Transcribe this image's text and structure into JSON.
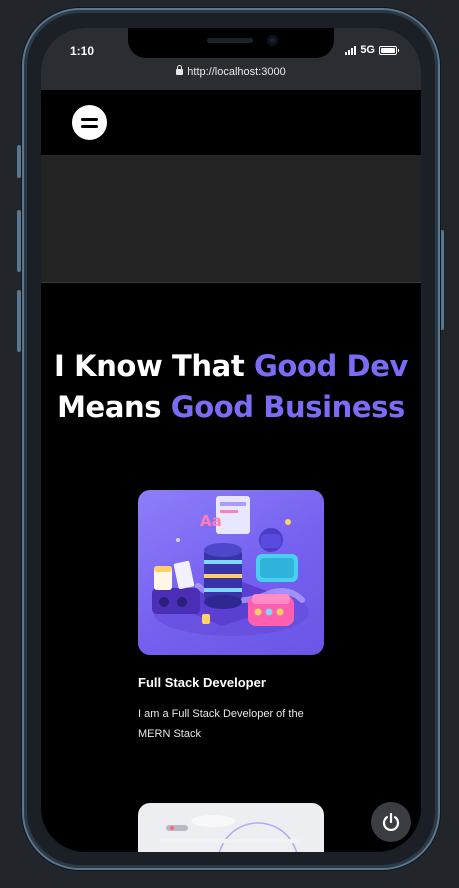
{
  "status_bar": {
    "time": "1:10",
    "network": "5G"
  },
  "browser": {
    "url": "http://localhost:3000"
  },
  "hero": {
    "line1_plain": "I Know That ",
    "line1_accent": "Good Dev",
    "line2_plain": "Means ",
    "line2_accent": "Good Business"
  },
  "services": [
    {
      "title": "Full Stack Developer",
      "description": "I am a Full Stack Developer of the MERN Stack"
    }
  ],
  "colors": {
    "accent": "#7b6cf6",
    "background": "#000000",
    "banner": "#242424",
    "frame": "#5b7790"
  },
  "icons": [
    "lock-icon",
    "signal-icon",
    "battery-icon",
    "menu-icon",
    "power-icon"
  ]
}
